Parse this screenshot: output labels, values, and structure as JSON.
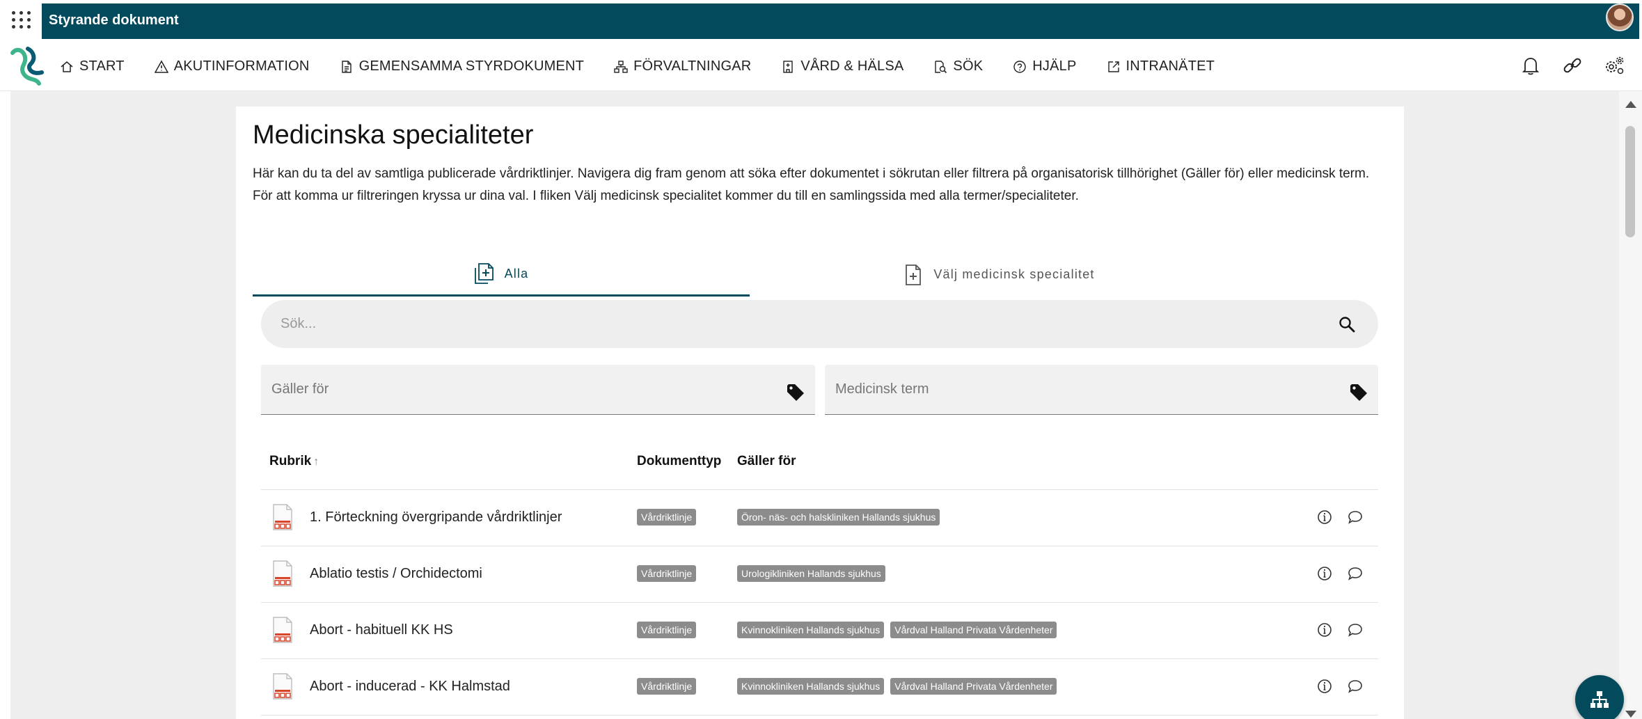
{
  "app": {
    "title": "Styrande dokument"
  },
  "nav": {
    "items": [
      {
        "label": "START",
        "icon": "home-icon"
      },
      {
        "label": "AKUTINFORMATION",
        "icon": "warning-icon"
      },
      {
        "label": "GEMENSAMMA STYRDOKUMENT",
        "icon": "document-icon"
      },
      {
        "label": "FÖRVALTNINGAR",
        "icon": "org-chart-icon"
      },
      {
        "label": "VÅRD & HÄLSA",
        "icon": "hospital-icon"
      },
      {
        "label": "SÖK",
        "icon": "search-doc-icon"
      },
      {
        "label": "HJÄLP",
        "icon": "help-icon"
      },
      {
        "label": "INTRANÄTET",
        "icon": "external-link-icon"
      }
    ]
  },
  "page": {
    "title": "Medicinska specialiteter",
    "intro": "Här kan du ta del av samtliga publicerade vårdriktlinjer. Navigera dig fram genom att söka efter dokumentet i sökrutan eller filtrera på organisatorisk tillhörighet (Gäller för) eller medicinsk term. För att komma ur filtreringen kryssa ur dina val. I fliken Välj medicinsk specialitet kommer du till en samlingssida med alla termer/specialiteter."
  },
  "tabs": [
    {
      "label": "Alla",
      "active": true
    },
    {
      "label": "Välj medicinsk specialitet",
      "active": false
    }
  ],
  "search": {
    "placeholder": "Sök..."
  },
  "filters": {
    "galler_for": "Gäller för",
    "medicinsk_term": "Medicinsk term"
  },
  "table": {
    "headers": {
      "rubrik": "Rubrik",
      "sort_arrow": "↑",
      "dokumenttyp": "Dokumenttyp",
      "galler_for": "Gäller för"
    },
    "rows": [
      {
        "rubrik": "1. Förteckning övergripande vårdriktlinjer",
        "typ": "Vårdriktlinje",
        "scopes": [
          "Öron- näs- och halskliniken Hallands sjukhus"
        ]
      },
      {
        "rubrik": "Ablatio testis / Orchidectomi",
        "typ": "Vårdriktlinje",
        "scopes": [
          "Urologikliniken Hallands sjukhus"
        ]
      },
      {
        "rubrik": "Abort - habituell KK HS",
        "typ": "Vårdriktlinje",
        "scopes": [
          "Kvinnokliniken Hallands sjukhus",
          "Vårdval Halland Privata Vårdenheter"
        ]
      },
      {
        "rubrik": "Abort - inducerad - KK Halmstad",
        "typ": "Vårdriktlinje",
        "scopes": [
          "Kvinnokliniken Hallands sjukhus",
          "Vårdval Halland Privata Vårdenheter"
        ]
      }
    ]
  },
  "colors": {
    "brand": "#024a5c",
    "badge": "#8c8c8c",
    "logo_green": "#3fb58c",
    "logo_blue": "#0a5a73",
    "pdf_red": "#d9452b"
  }
}
